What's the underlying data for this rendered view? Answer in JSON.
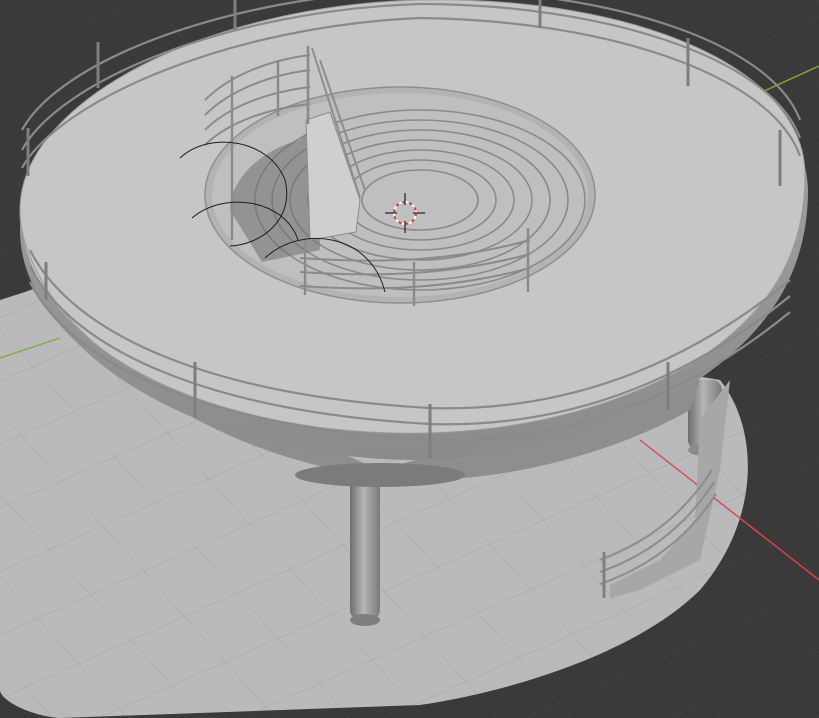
{
  "viewport": {
    "view_type": "3d-viewport",
    "background_color": "#3a3a3a",
    "ground_plane_color": "#b9bbbc",
    "grid_color": "#9fa1a2",
    "model_color": "#bcbcbc",
    "axis_x_color": "#e0454b",
    "axis_y_color": "#7fb032",
    "cursor_color": "#e03434",
    "icons": {
      "cursor": "3d-cursor-icon",
      "light": "light-gizmo-icon"
    }
  },
  "scene": {
    "object": "spiral-staircase-platform",
    "parts": [
      "ground-slab",
      "support-columns",
      "circular-deck",
      "outer-railing",
      "central-stairwell",
      "spiral-stairs",
      "stair-railings"
    ]
  }
}
